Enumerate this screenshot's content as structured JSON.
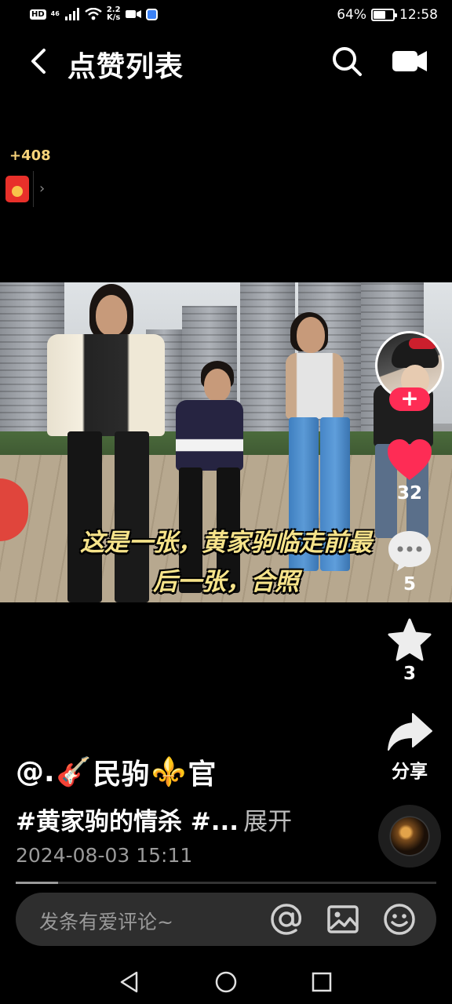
{
  "status_bar": {
    "hd_badge": "HD",
    "network": "46",
    "speed_value": "2.2",
    "speed_unit": "K/s",
    "battery_percent": "64%",
    "battery_level": 0.64,
    "time": "12:58"
  },
  "header": {
    "title": "点赞列表",
    "back_icon": "chevron-left-icon",
    "search_icon": "search-icon",
    "camera_icon": "video-camera-icon"
  },
  "reward": {
    "count": "+408",
    "icon": "red-packet-icon",
    "chevron": "›"
  },
  "video": {
    "subtitle_line1": "这是一张，黄家驹临走前最",
    "subtitle_line2": "后一张，合照"
  },
  "actions": {
    "follow_label": "+",
    "like_count": "32",
    "comment_count": "5",
    "favorite_count": "3",
    "share_label": "分享",
    "like_color": "#fe2c55"
  },
  "caption": {
    "author_prefix": "@.",
    "author_emoji_1": "🎸",
    "author_name": "民驹",
    "author_emoji_2": "⚜️",
    "author_suffix": "官",
    "hashtags": "#黄家驹的情杀 #...",
    "expand_label": "展开",
    "timestamp": "2024-08-03 15:11"
  },
  "progress": {
    "played_fraction": 0.1
  },
  "comment_bar": {
    "placeholder": "发条有爱评论~",
    "at_icon": "at-icon",
    "image_icon": "image-icon",
    "emoji_icon": "emoji-icon"
  },
  "nav": {
    "back_icon": "triangle-back-icon",
    "home_icon": "circle-home-icon",
    "recent_icon": "square-recent-icon"
  }
}
